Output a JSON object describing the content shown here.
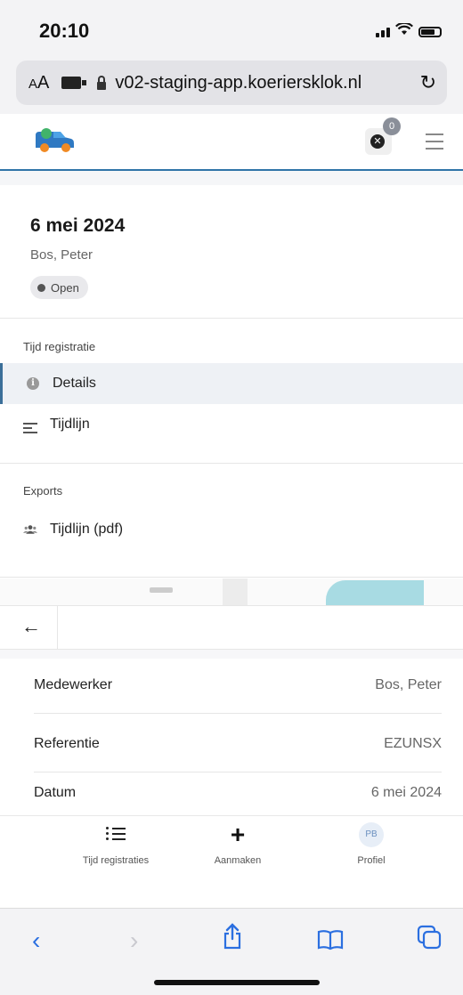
{
  "status": {
    "time": "20:10"
  },
  "browser": {
    "text_size_label": "AA",
    "url": "v02-staging-app.koeriersklok.nl",
    "reload_icon": "reload-icon"
  },
  "header": {
    "notification_count": "0",
    "logo_icon": "delivery-van-icon",
    "menu_icon": "hamburger-icon"
  },
  "record": {
    "date": "6 mei 2024",
    "employee": "Bos, Peter",
    "status": "Open"
  },
  "sections": {
    "tijd_registratie": {
      "label": "Tijd registratie",
      "items": [
        {
          "label": "Details",
          "icon": "info-icon",
          "active": true
        },
        {
          "label": "Tijdlijn",
          "icon": "timeline-icon",
          "active": false
        }
      ]
    },
    "exports": {
      "label": "Exports",
      "items": [
        {
          "label": "Tijdlijn (pdf)",
          "icon": "users-icon"
        }
      ]
    }
  },
  "details": {
    "rows": [
      {
        "label": "Medewerker",
        "value": "Bos, Peter"
      },
      {
        "label": "Referentie",
        "value": "EZUNSX"
      },
      {
        "label": "Datum",
        "value": "6 mei 2024"
      }
    ]
  },
  "tabbar": {
    "tabs": [
      {
        "label": "Tijd registraties",
        "icon": "list-icon"
      },
      {
        "label": "Aanmaken",
        "icon": "plus-icon"
      },
      {
        "label": "Profiel",
        "avatar": "PB"
      }
    ]
  },
  "colors": {
    "accent": "#2f74a8",
    "safari_blue": "#2b6fe0"
  }
}
